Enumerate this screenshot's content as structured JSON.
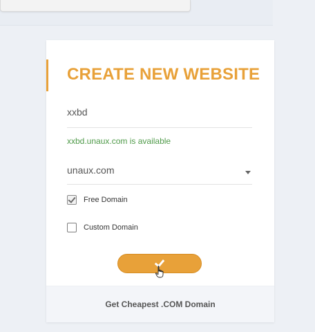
{
  "form": {
    "title": "CREATE NEW WEBSITE",
    "domain_value": "xxbd",
    "availability_message": "xxbd.unaux.com is available",
    "selected_domain": "unaux.com",
    "free_domain_label": "Free Domain",
    "free_domain_checked": true,
    "custom_domain_label": "Custom Domain",
    "custom_domain_checked": false,
    "submit_icon": "check-icon"
  },
  "footer": {
    "link_label": "Get Cheapest .COM Domain"
  },
  "colors": {
    "accent": "#e8a139",
    "success": "#4f9a49",
    "background": "#edf0f5"
  }
}
